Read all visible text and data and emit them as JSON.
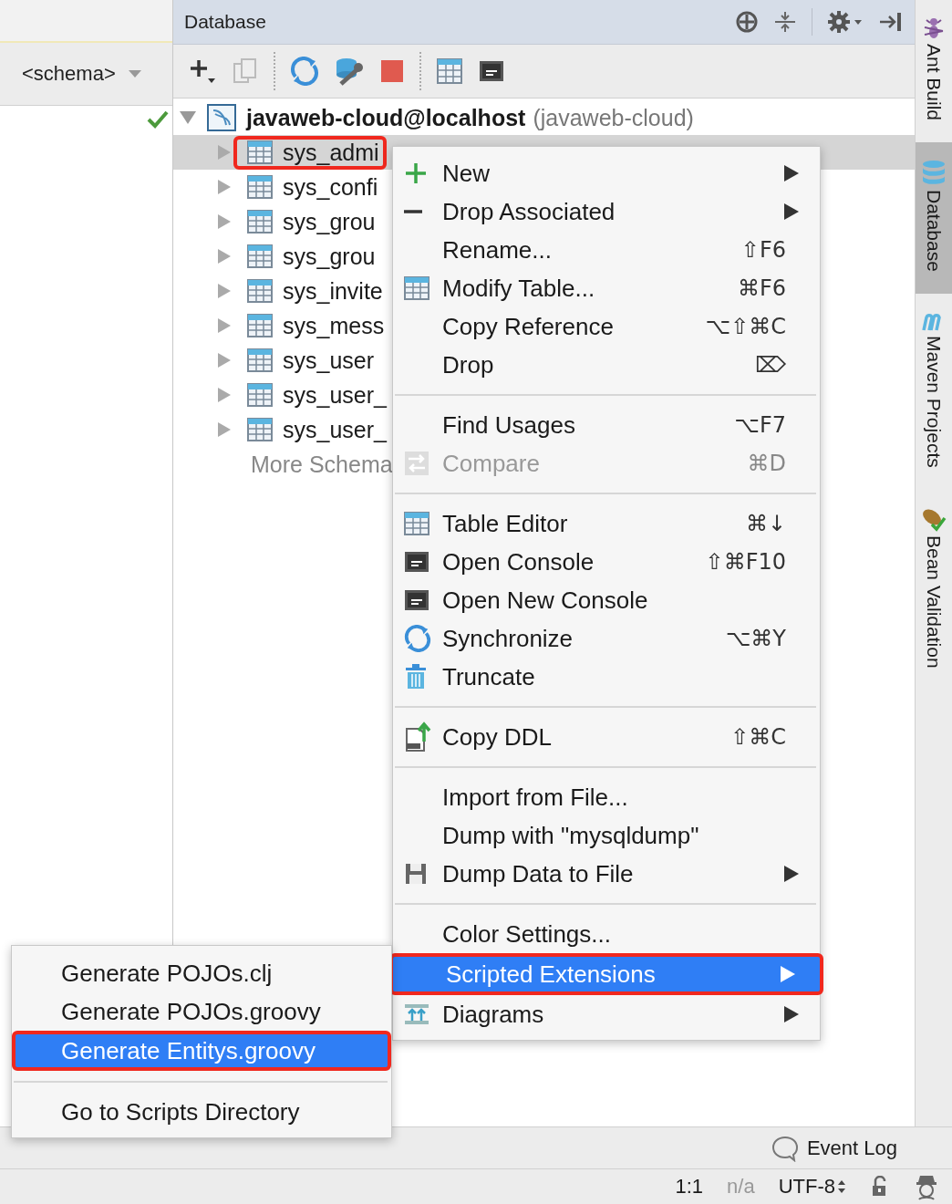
{
  "left_panel": {
    "schema_dropdown": "<schema>"
  },
  "panel": {
    "title": "Database"
  },
  "tree": {
    "root": {
      "name": "javaweb-cloud@localhost",
      "detail": "(javaweb-cloud)",
      "expanded": true
    },
    "items": [
      {
        "name": "sys_admi",
        "selected": true,
        "expanded": false,
        "outlined": true
      },
      {
        "name": "sys_confi",
        "selected": false,
        "expanded": false,
        "outlined": false
      },
      {
        "name": "sys_grou",
        "selected": false,
        "expanded": false,
        "outlined": false
      },
      {
        "name": "sys_grou",
        "selected": false,
        "expanded": false,
        "outlined": false
      },
      {
        "name": "sys_invite",
        "selected": false,
        "expanded": false,
        "outlined": false
      },
      {
        "name": "sys_mess",
        "selected": false,
        "expanded": false,
        "outlined": false
      },
      {
        "name": "sys_user",
        "selected": false,
        "expanded": false,
        "outlined": false
      },
      {
        "name": "sys_user_",
        "selected": false,
        "expanded": false,
        "outlined": false
      },
      {
        "name": "sys_user_",
        "selected": false,
        "expanded": false,
        "outlined": false
      }
    ],
    "more": "More Schema"
  },
  "context_menu": [
    {
      "kind": "item",
      "label": "New",
      "submenu": true,
      "selected": false,
      "disabled": false
    },
    {
      "kind": "item",
      "label": "Drop Associated",
      "submenu": true,
      "selected": false,
      "disabled": false
    },
    {
      "kind": "item",
      "label": "Rename...",
      "shortcut": "⇧F6",
      "submenu": false,
      "selected": false,
      "disabled": false
    },
    {
      "kind": "item",
      "label": "Modify Table...",
      "shortcut": "⌘F6",
      "submenu": false,
      "selected": false,
      "disabled": false
    },
    {
      "kind": "item",
      "label": "Copy Reference",
      "shortcut": "⌥⇧⌘C",
      "submenu": false,
      "selected": false,
      "disabled": false
    },
    {
      "kind": "item",
      "label": "Drop",
      "shortcut": "⌦",
      "submenu": false,
      "selected": false,
      "disabled": false
    },
    {
      "kind": "separator"
    },
    {
      "kind": "item",
      "label": "Find Usages",
      "shortcut": "⌥F7",
      "submenu": false,
      "selected": false,
      "disabled": false
    },
    {
      "kind": "item",
      "label": "Compare",
      "shortcut": "⌘D",
      "submenu": false,
      "selected": false,
      "disabled": true
    },
    {
      "kind": "separator"
    },
    {
      "kind": "item",
      "label": "Table Editor",
      "shortcut": "⌘↓",
      "submenu": false,
      "selected": false,
      "disabled": false
    },
    {
      "kind": "item",
      "label": "Open Console",
      "shortcut": "⇧⌘F10",
      "submenu": false,
      "selected": false,
      "disabled": false
    },
    {
      "kind": "item",
      "label": "Open New Console",
      "submenu": false,
      "selected": false,
      "disabled": false
    },
    {
      "kind": "item",
      "label": "Synchronize",
      "shortcut": "⌥⌘Y",
      "submenu": false,
      "selected": false,
      "disabled": false
    },
    {
      "kind": "item",
      "label": "Truncate",
      "submenu": false,
      "selected": false,
      "disabled": false
    },
    {
      "kind": "separator"
    },
    {
      "kind": "item",
      "label": "Copy DDL",
      "shortcut": "⇧⌘C",
      "submenu": false,
      "selected": false,
      "disabled": false
    },
    {
      "kind": "separator"
    },
    {
      "kind": "item",
      "label": "Import from File...",
      "submenu": false,
      "selected": false,
      "disabled": false
    },
    {
      "kind": "item",
      "label": "Dump with \"mysqldump\"",
      "submenu": false,
      "selected": false,
      "disabled": false
    },
    {
      "kind": "item",
      "label": "Dump Data to File",
      "submenu": true,
      "selected": false,
      "disabled": false
    },
    {
      "kind": "separator"
    },
    {
      "kind": "item",
      "label": "Color Settings...",
      "submenu": false,
      "selected": false,
      "disabled": false
    },
    {
      "kind": "item",
      "label": "Scripted Extensions",
      "submenu": true,
      "selected": true,
      "disabled": false
    },
    {
      "kind": "item",
      "label": "Diagrams",
      "submenu": true,
      "selected": false,
      "disabled": false
    }
  ],
  "submenu": [
    {
      "kind": "item",
      "label": "Generate POJOs.clj",
      "selected": false
    },
    {
      "kind": "item",
      "label": "Generate POJOs.groovy",
      "selected": false
    },
    {
      "kind": "item",
      "label": "Generate Entitys.groovy",
      "selected": true
    },
    {
      "kind": "separator"
    },
    {
      "kind": "item",
      "label": "Go to Scripts Directory",
      "selected": false
    }
  ],
  "side_tabs": [
    {
      "label": "Ant Build",
      "selected": false
    },
    {
      "label": "Database",
      "selected": true
    },
    {
      "label": "Maven Projects",
      "selected": false
    },
    {
      "label": "Bean Validation",
      "selected": false
    }
  ],
  "event_log": "Event Log",
  "status_bar": {
    "position": "1:1",
    "line_separator": "n/a",
    "encoding": "UTF-8"
  }
}
